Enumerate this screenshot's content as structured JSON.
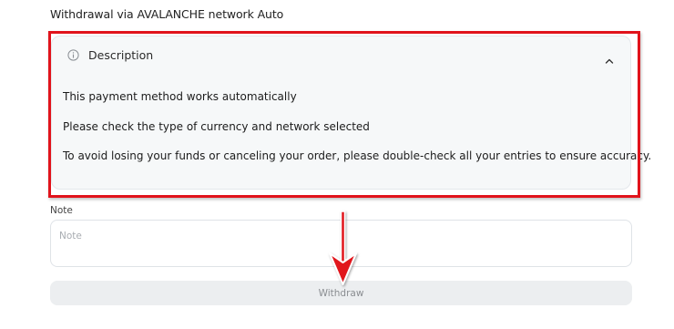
{
  "title": "Withdrawal via AVALANCHE network Auto",
  "description": {
    "heading": "Description",
    "lines": [
      "This payment method works automatically",
      "Please check the type of currency and network selected",
      "To avoid losing your funds or canceling your order, please double-check all your entries to ensure accuracy."
    ]
  },
  "note": {
    "label": "Note",
    "placeholder": "Note",
    "value": ""
  },
  "withdraw_button": "Withdraw",
  "icons": {
    "info": "info-circle-icon",
    "collapse": "chevron-up-icon",
    "annotation_arrow": "down-arrow-annotation"
  },
  "colors": {
    "highlight": "#e1131b",
    "panel_bg": "#f6f8f9",
    "button_bg": "#eceef0"
  }
}
